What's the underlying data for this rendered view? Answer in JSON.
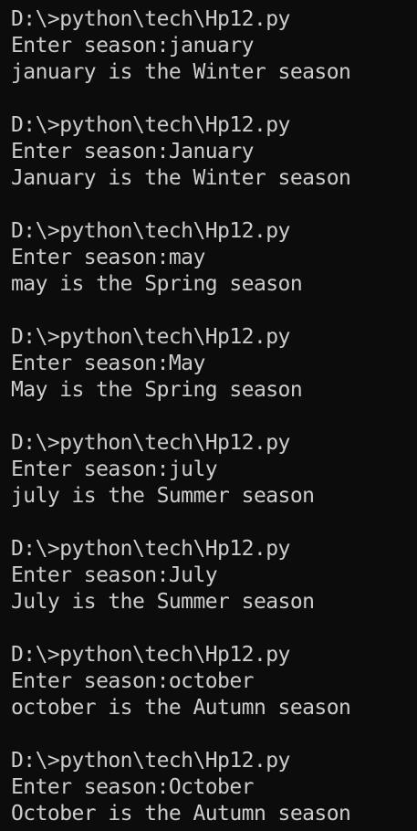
{
  "terminal": {
    "blocks": [
      {
        "command": "D:\\>python\\tech\\Hp12.py",
        "prompt": "Enter season:january",
        "output": "january is the Winter season"
      },
      {
        "command": "D:\\>python\\tech\\Hp12.py",
        "prompt": "Enter season:January",
        "output": "January is the Winter season"
      },
      {
        "command": "D:\\>python\\tech\\Hp12.py",
        "prompt": "Enter season:may",
        "output": "may is the Spring season"
      },
      {
        "command": "D:\\>python\\tech\\Hp12.py",
        "prompt": "Enter season:May",
        "output": "May is the Spring season"
      },
      {
        "command": "D:\\>python\\tech\\Hp12.py",
        "prompt": "Enter season:july",
        "output": "july is the Summer season"
      },
      {
        "command": "D:\\>python\\tech\\Hp12.py",
        "prompt": "Enter season:July",
        "output": "July is the Summer season"
      },
      {
        "command": "D:\\>python\\tech\\Hp12.py",
        "prompt": "Enter season:october",
        "output": "october is the Autumn season"
      },
      {
        "command": "D:\\>python\\tech\\Hp12.py",
        "prompt": "Enter season:October",
        "output": "October is the Autumn season"
      }
    ]
  },
  "colors": {
    "background": "#0c0c0c",
    "text": "#cccccc"
  }
}
